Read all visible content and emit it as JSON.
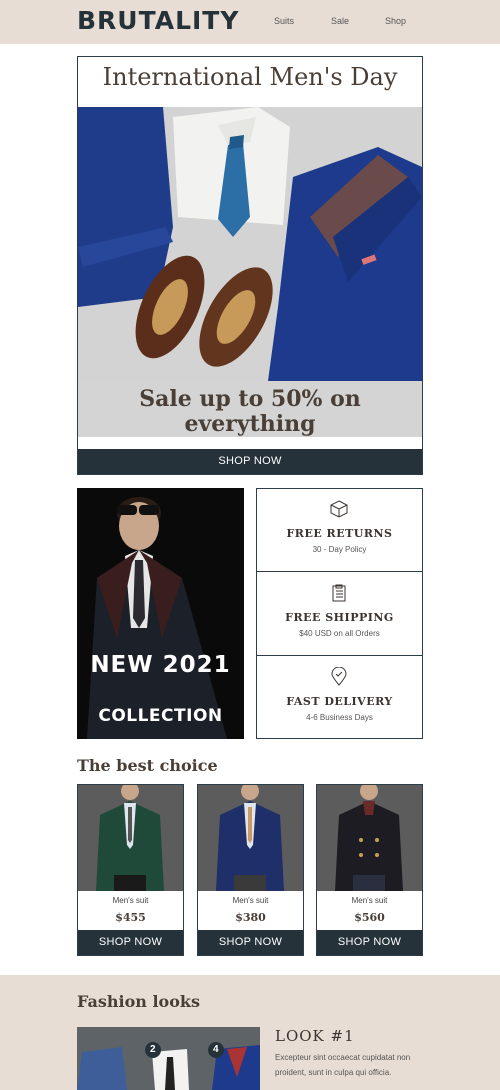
{
  "header": {
    "logo": "BRUTALITY",
    "nav": [
      {
        "label": "Suits"
      },
      {
        "label": "Sale"
      },
      {
        "label": "Shop"
      }
    ]
  },
  "hero": {
    "title": "International Men's Day",
    "sale_line1": "Sale up to 50% on",
    "sale_line2": "everything",
    "button": "SHOP NOW"
  },
  "collection": {
    "line1": "NEW 2021",
    "line2": "COLLECTION"
  },
  "features": [
    {
      "icon": "box-icon",
      "title": "FREE RETURNS",
      "subtitle": "30 - Day Policy"
    },
    {
      "icon": "clipboard-icon",
      "title": "FREE SHIPPING",
      "subtitle": "$40 USD on all Orders"
    },
    {
      "icon": "location-pin-icon",
      "title": "FAST DELIVERY",
      "subtitle": "4-6 Business Days"
    }
  ],
  "best_choice": {
    "title": "The best choice",
    "products": [
      {
        "name": "Men's suit",
        "price": "$455",
        "button": "SHOP NOW",
        "suit_color": "#1f4a3a"
      },
      {
        "name": "Men's suit",
        "price": "$380",
        "button": "SHOP NOW",
        "suit_color": "#1e2f6a"
      },
      {
        "name": "Men's suit",
        "price": "$560",
        "button": "SHOP NOW",
        "suit_color": "#1c1c22"
      }
    ]
  },
  "fashion_looks": {
    "title": "Fashion looks",
    "look_title": "LOOK #1",
    "look_desc": "Excepteur sint occaecat cupidatat non proident, sunt in culpa qui officia.",
    "badges": [
      "2",
      "4"
    ]
  },
  "colors": {
    "dark": "#25323a",
    "beige": "#e8ddd5",
    "heading": "#4a3f37"
  }
}
